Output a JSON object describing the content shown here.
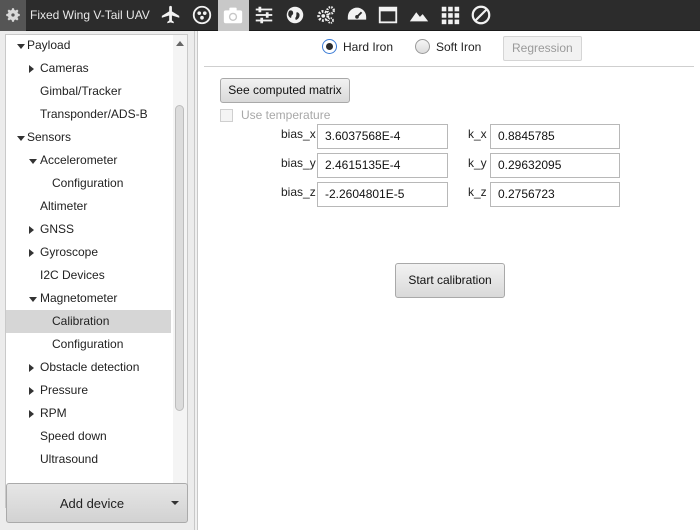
{
  "window": {
    "title": "Fixed Wing V-Tail UAV"
  },
  "toolbar": {
    "icons": [
      {
        "name": "airplane-icon",
        "active": false
      },
      {
        "name": "dots-circle-icon",
        "active": false
      },
      {
        "name": "camera-icon",
        "active": true
      },
      {
        "name": "sliders-icon",
        "active": false
      },
      {
        "name": "globe-icon",
        "active": false
      },
      {
        "name": "gears-icon",
        "active": false
      },
      {
        "name": "gauge-icon",
        "active": false
      },
      {
        "name": "window-icon",
        "active": false
      },
      {
        "name": "mountain-icon",
        "active": false
      },
      {
        "name": "grid-icon",
        "active": false
      },
      {
        "name": "prohibited-icon",
        "active": false
      }
    ]
  },
  "sidebar": {
    "items": [
      {
        "label": "Payload",
        "level": 0,
        "expander": "down"
      },
      {
        "label": "Cameras",
        "level": 1,
        "expander": "right"
      },
      {
        "label": "Gimbal/Tracker",
        "level": 1,
        "expander": ""
      },
      {
        "label": "Transponder/ADS-B",
        "level": 1,
        "expander": ""
      },
      {
        "label": "Sensors",
        "level": 0,
        "expander": "down"
      },
      {
        "label": "Accelerometer",
        "level": 1,
        "expander": "down"
      },
      {
        "label": "Configuration",
        "level": 2,
        "expander": ""
      },
      {
        "label": "Altimeter",
        "level": 1,
        "expander": ""
      },
      {
        "label": "GNSS",
        "level": 1,
        "expander": "right"
      },
      {
        "label": "Gyroscope",
        "level": 1,
        "expander": "right"
      },
      {
        "label": "I2C Devices",
        "level": 1,
        "expander": ""
      },
      {
        "label": "Magnetometer",
        "level": 1,
        "expander": "down"
      },
      {
        "label": "Calibration",
        "level": 2,
        "expander": "",
        "selected": true
      },
      {
        "label": "Configuration",
        "level": 2,
        "expander": ""
      },
      {
        "label": "Obstacle detection",
        "level": 1,
        "expander": "right"
      },
      {
        "label": "Pressure",
        "level": 1,
        "expander": "right"
      },
      {
        "label": "RPM",
        "level": 1,
        "expander": "right"
      },
      {
        "label": "Speed down",
        "level": 1,
        "expander": ""
      },
      {
        "label": "Ultrasound",
        "level": 1,
        "expander": ""
      }
    ],
    "add_device_label": "Add device"
  },
  "main": {
    "mode": {
      "hard_iron_label": "Hard Iron",
      "soft_iron_label": "Soft Iron",
      "regression_label": "Regression",
      "selected": "hard_iron"
    },
    "see_matrix_label": "See computed matrix",
    "use_temperature_label": "Use temperature",
    "fields": {
      "bias_x": {
        "label": "bias_x",
        "value": "3.6037568E-4"
      },
      "bias_y": {
        "label": "bias_y",
        "value": "2.4615135E-4"
      },
      "bias_z": {
        "label": "bias_z",
        "value": "-2.2604801E-5"
      },
      "k_x": {
        "label": "k_x",
        "value": "0.8845785"
      },
      "k_y": {
        "label": "k_y",
        "value": "0.29632095"
      },
      "k_z": {
        "label": "k_z",
        "value": "0.2756723"
      }
    },
    "start_calibration_label": "Start calibration"
  }
}
